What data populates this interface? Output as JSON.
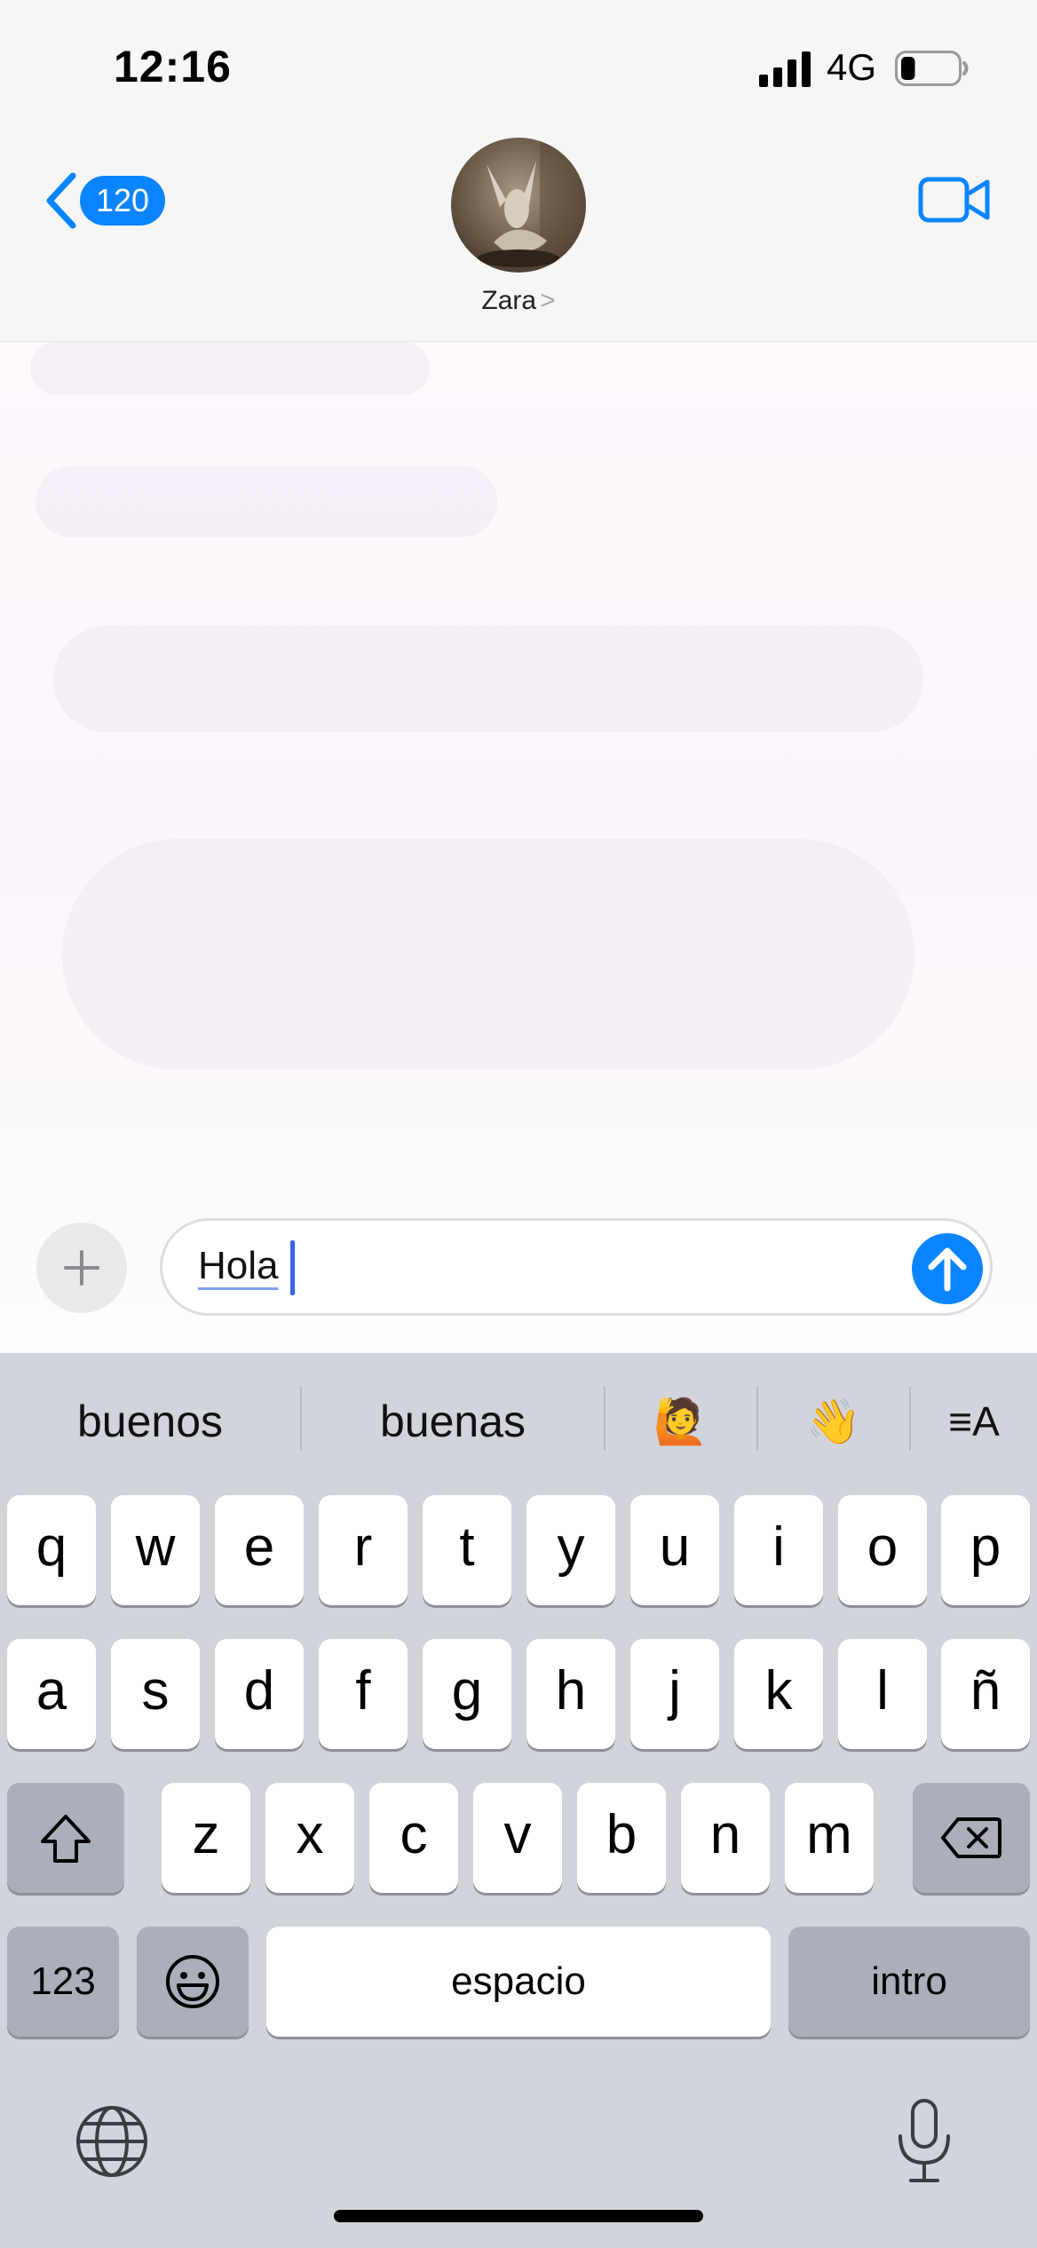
{
  "status_bar": {
    "time": "12:16",
    "network": "4G",
    "battery_level": 0.25
  },
  "header": {
    "back_count": "120",
    "contact_name": "Zara",
    "contact_chevron": ">",
    "accent_color": "#0a84ff"
  },
  "composer": {
    "text": "Hola",
    "plus_icon": "plus-icon",
    "send_icon": "arrow-up-icon"
  },
  "keyboard": {
    "suggestions": [
      "buenos",
      "buenas",
      "🙋",
      "👋"
    ],
    "format_icon": "≡A",
    "rows": [
      [
        "q",
        "w",
        "e",
        "r",
        "t",
        "y",
        "u",
        "i",
        "o",
        "p"
      ],
      [
        "a",
        "s",
        "d",
        "f",
        "g",
        "h",
        "j",
        "k",
        "l",
        "ñ"
      ],
      [
        "z",
        "x",
        "c",
        "v",
        "b",
        "n",
        "m"
      ]
    ],
    "numbers_label": "123",
    "emoji_icon": "emoji-icon",
    "space_label": "espacio",
    "return_label": "intro",
    "globe_icon": "globe-icon",
    "mic_icon": "microphone-icon"
  }
}
